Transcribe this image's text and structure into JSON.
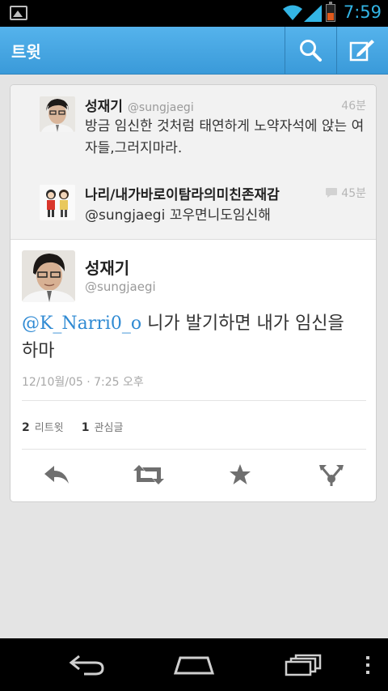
{
  "status_bar": {
    "time": "7:59",
    "icons": [
      "picture-icon",
      "wifi-icon",
      "signal-icon",
      "battery-icon"
    ]
  },
  "action_bar": {
    "title": "트윗",
    "actions": [
      "search-icon",
      "compose-icon"
    ]
  },
  "replies": [
    {
      "name": "성재기",
      "handle": "@sungjaegi",
      "time": "46분",
      "text": "방금 임신한 것처럼 태연하게 노약자석에 앉는 여자들,그러지마라."
    },
    {
      "name": "나리/내가바로이탐라의미친존재감",
      "handle": "",
      "time": "45분",
      "text": "@sungjaegi 꼬우면니도임신해"
    }
  ],
  "tweet": {
    "name": "성재기",
    "handle": "@sungjaegi",
    "mention": "@K_Narri0_o",
    "text": " 니가 발기하면 내가 임신을 하마",
    "date": "12/10월/05 · 7:25 오후",
    "retweets_count": "2",
    "retweets_label": "리트윗",
    "favorites_count": "1",
    "favorites_label": "관심글"
  },
  "tweet_actions": [
    "reply-icon",
    "retweet-icon",
    "favorite-icon",
    "share-icon"
  ],
  "nav_bar": [
    "back-icon",
    "home-icon",
    "recent-apps-icon",
    "menu-icon"
  ],
  "colors": {
    "action_bar": "#4aa8e6",
    "mention": "#2f8ad3",
    "clock": "#33b5e5",
    "battery": "#e05a1c"
  }
}
